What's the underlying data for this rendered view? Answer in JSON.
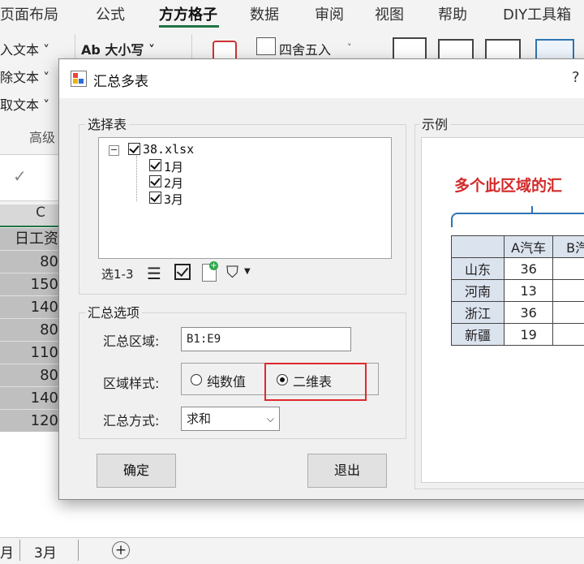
{
  "ribbon": {
    "tabs": [
      "页面布局",
      "公式",
      "方方格子",
      "数据",
      "审阅",
      "视图",
      "帮助",
      "DIY工具箱"
    ],
    "active_tab": "方方格子",
    "left_items": [
      "入文本 ˅",
      "除文本 ˅",
      "取文本 ˅"
    ],
    "case_button": "Ab 大小写 ˅",
    "round_button": "四舍五入",
    "group_label": "高级"
  },
  "sheet": {
    "column_header": "C",
    "values": [
      "日工资",
      "80",
      "150",
      "140",
      "80",
      "110",
      "80",
      "140",
      "120"
    ],
    "tabs": [
      "月",
      "3月"
    ],
    "add_sheet": "+"
  },
  "dialog": {
    "title": "汇总多表",
    "help": "?",
    "select_group": {
      "label": "选择表",
      "tree": [
        {
          "label": "38.xlsx",
          "checked": true
        },
        {
          "label": "1月",
          "checked": true
        },
        {
          "label": "2月",
          "checked": true
        },
        {
          "label": "3月",
          "checked": true
        }
      ],
      "selection_count": "选1-3"
    },
    "options_group": {
      "label": "汇总选项",
      "range_label": "汇总区域:",
      "range_value": "B1:E9",
      "style_label": "区域样式:",
      "style_options": [
        "纯数值",
        "二维表"
      ],
      "style_selected": "二维表",
      "method_label": "汇总方式:",
      "method_value": "求和"
    },
    "ok_button": "确定",
    "exit_button": "退出",
    "preview": {
      "label": "示例",
      "headline": "多个此区域的汇",
      "table_headers": [
        "A汽车",
        "B汽"
      ],
      "table_rows": [
        {
          "name": "山东",
          "value": "36"
        },
        {
          "name": "河南",
          "value": "13"
        },
        {
          "name": "浙江",
          "value": "36"
        },
        {
          "name": "新疆",
          "value": "19"
        }
      ]
    }
  },
  "colors": {
    "accent_green": "#217346",
    "highlight_red": "#e0282c",
    "headline_red": "#d22a2a",
    "brace_blue": "#2e74b5"
  }
}
